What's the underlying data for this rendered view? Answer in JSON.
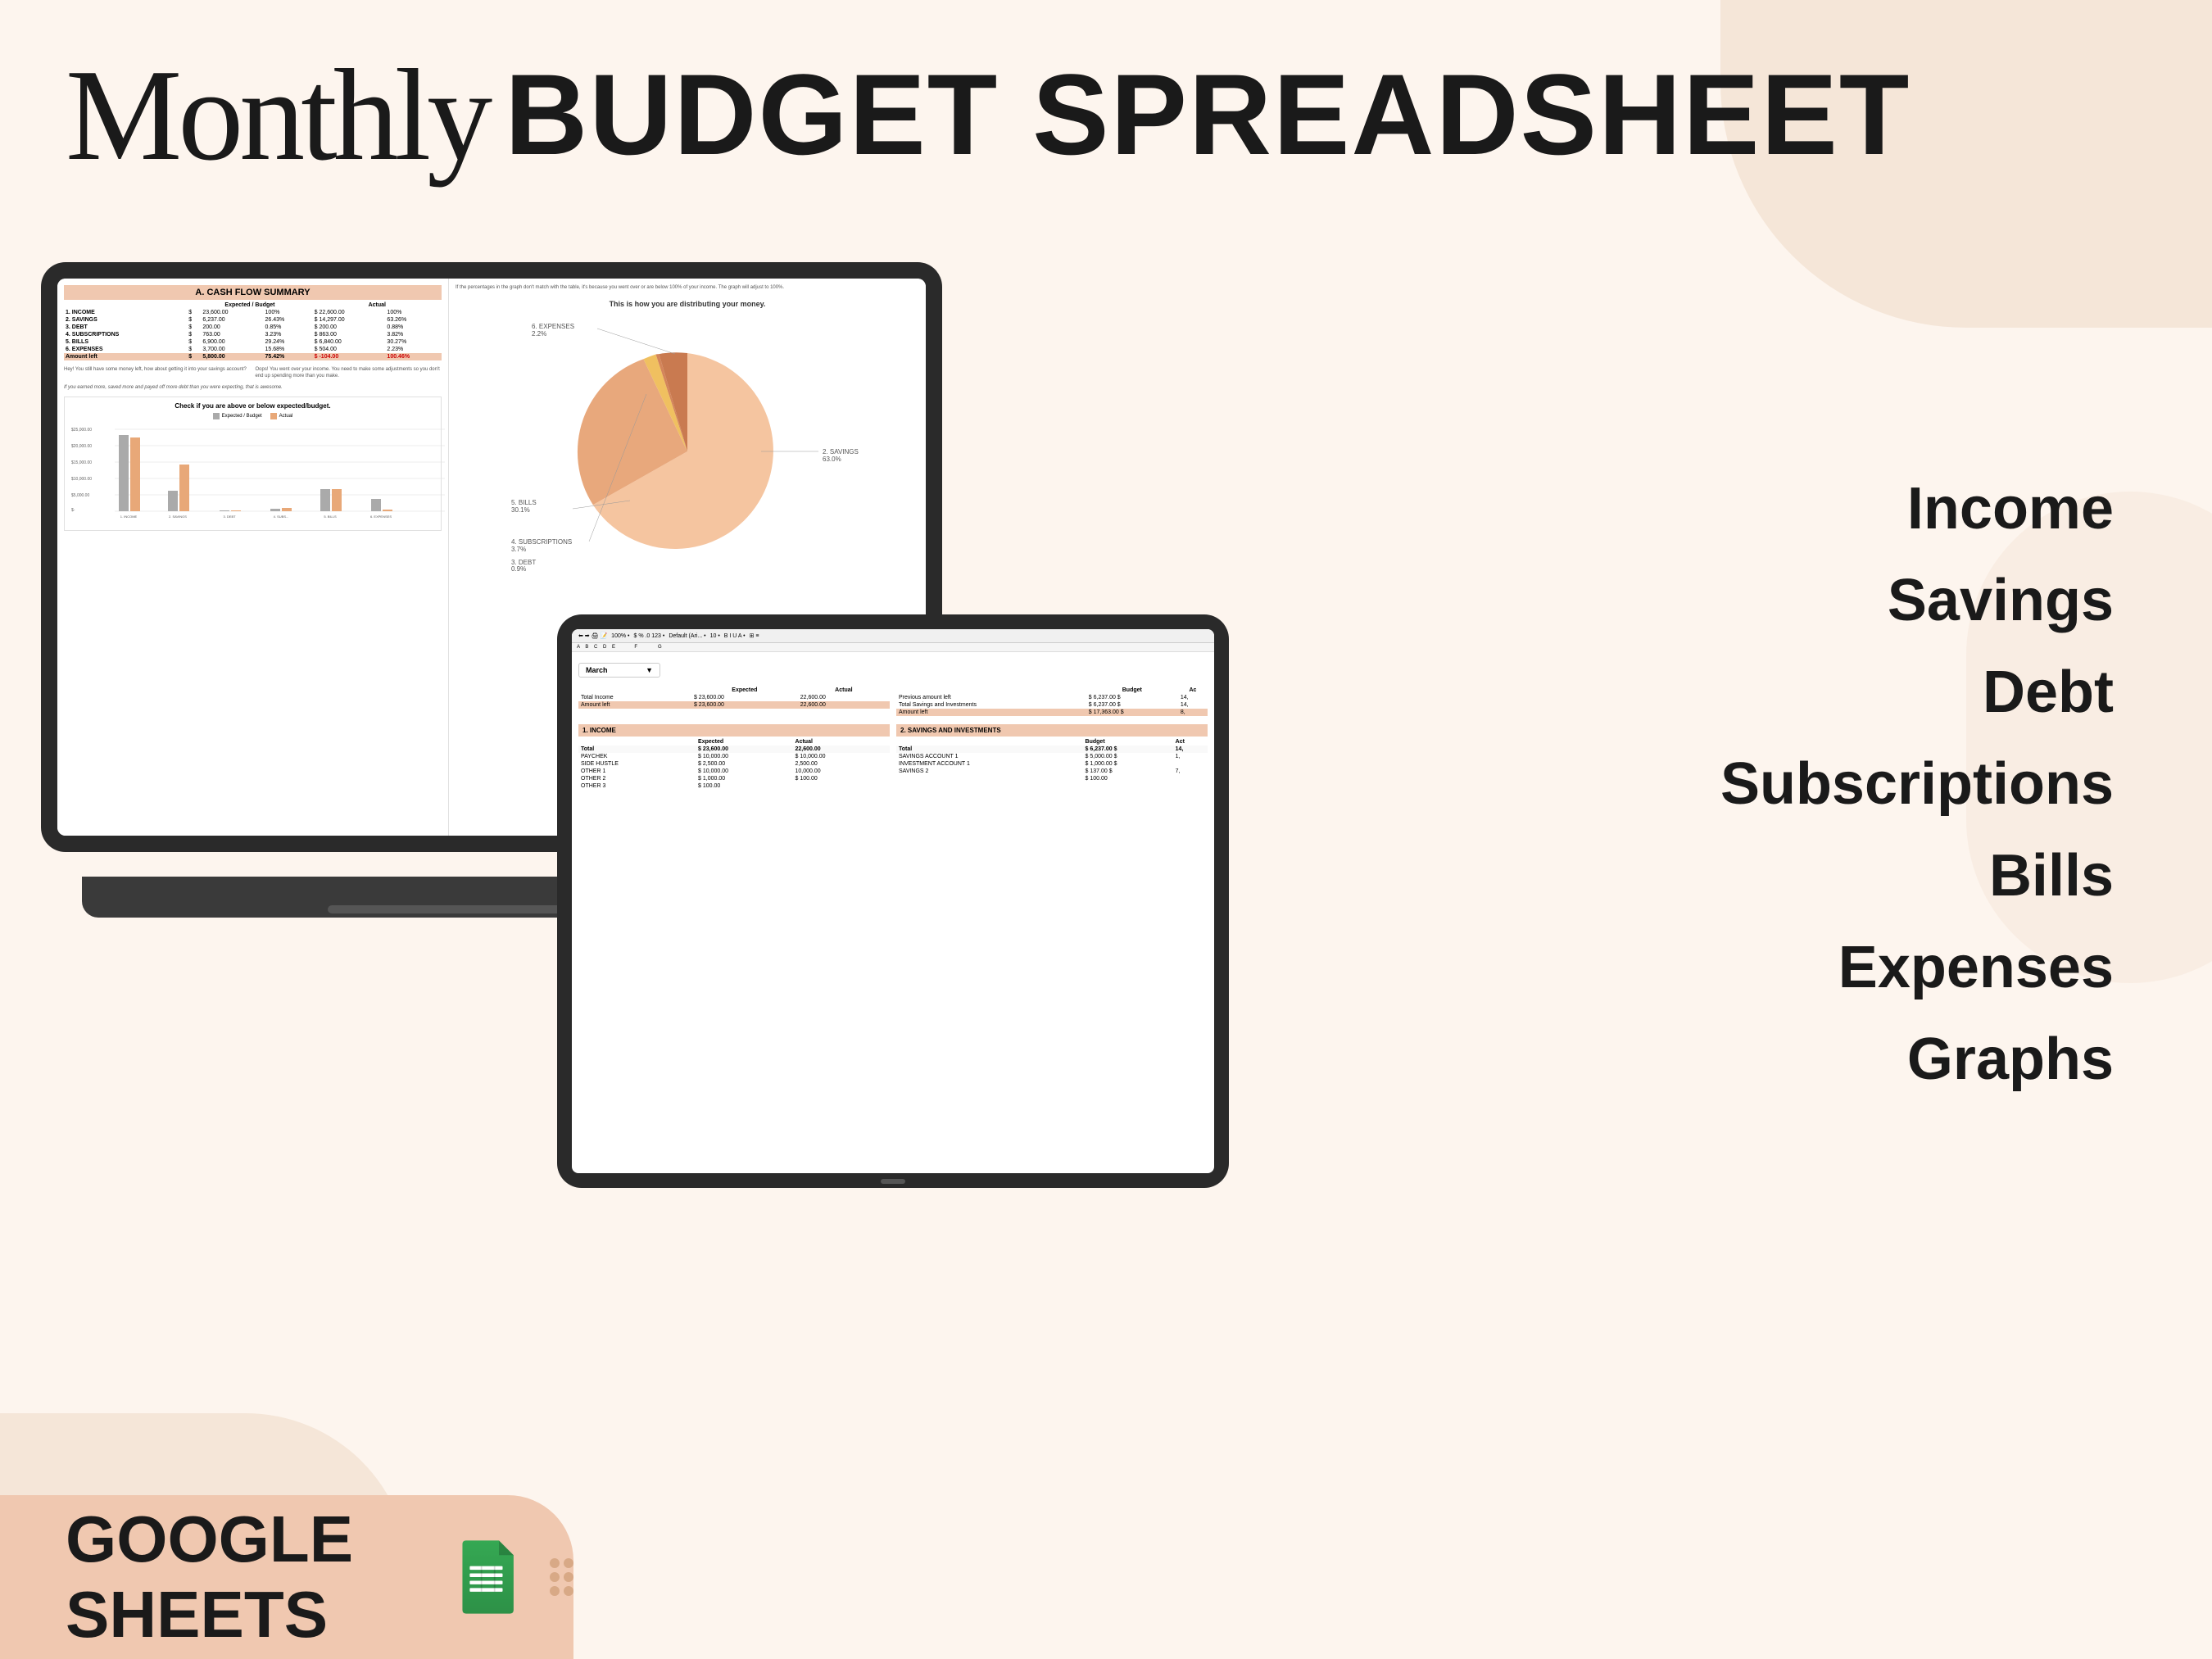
{
  "header": {
    "monthly_script": "Monthly",
    "budget_spreadsheet": "BUDGET SPREADSHEET"
  },
  "features": {
    "items": [
      "Income",
      "Savings",
      "Debt",
      "Subscriptions",
      "Bills",
      "Expenses",
      "Graphs"
    ]
  },
  "laptop": {
    "cash_flow": {
      "title": "A. CASH FLOW SUMMARY",
      "col_expected": "Expected / Budget",
      "col_actual": "Actual",
      "rows": [
        {
          "label": "1. INCOME",
          "exp_dollar": "$",
          "exp_val": "23,600.00",
          "exp_pct": "100%",
          "act_dollar": "$",
          "act_val": "22,600.00",
          "act_pct": "100%"
        },
        {
          "label": "2. SAVINGS",
          "exp_dollar": "$",
          "exp_val": "6,237.00",
          "exp_pct": "26.43%",
          "act_dollar": "$",
          "act_val": "14,297.00",
          "act_pct": "63.26%"
        },
        {
          "label": "3. DEBT",
          "exp_dollar": "$",
          "exp_val": "200.00",
          "exp_pct": "0.85%",
          "act_dollar": "$",
          "act_val": "200.00",
          "act_pct": "0.88%"
        },
        {
          "label": "4. SUBSCRIPTIONS",
          "exp_dollar": "$",
          "exp_val": "763.00",
          "exp_pct": "3.23%",
          "act_dollar": "$",
          "act_val": "863.00",
          "act_pct": "3.82%"
        },
        {
          "label": "5. BILLS",
          "exp_dollar": "$",
          "exp_val": "6,900.00",
          "exp_pct": "29.24%",
          "act_dollar": "$",
          "act_val": "6,840.00",
          "act_pct": "30.27%"
        },
        {
          "label": "6. EXPENSES",
          "exp_dollar": "$",
          "exp_val": "3,700.00",
          "exp_pct": "15.68%",
          "act_dollar": "$",
          "act_val": "504.00",
          "act_pct": "2.23%"
        }
      ],
      "amount_left_label": "Amount left",
      "amount_left_exp": "5,800.00",
      "amount_left_exp_pct": "75.42%",
      "amount_left_act": "-104.00",
      "amount_left_act_pct": "100.46%",
      "note_positive": "Hey! You still have some money left, how about getting it into your savings account?",
      "note_negative": "Oops! You went over your income. You need to make some adjustments so you don't end up spending more than you make.",
      "italic_note": "If you earned more, saved more and payed off more debt than you were expecting, that is awesome."
    },
    "pie_chart": {
      "disclaimer": "If the percentages in the graph don't match with the table, it's because you went over or are below 100% of your income. The graph will adjust to 100%.",
      "title": "This is how you are distributing your money.",
      "segments": [
        {
          "label": "2. SAVINGS",
          "pct": "63.0%",
          "color": "#f5c5a0"
        },
        {
          "label": "5. BILLS",
          "pct": "30.1%",
          "color": "#e8a87c"
        },
        {
          "label": "4. SUBSCRIPTIONS",
          "pct": "3.7%",
          "color": "#f0c060"
        },
        {
          "label": "3. DEBT",
          "pct": "0.9%",
          "color": "#d4855a"
        },
        {
          "label": "6. EXPENSES",
          "pct": "2.2%",
          "color": "#c97a50"
        }
      ]
    },
    "bar_chart": {
      "title": "Check if you are above or below expected/budget.",
      "legend_expected": "Expected / Budget",
      "legend_actual": "Actual",
      "categories": [
        "1. INCOME",
        "2. SAVINGS",
        "3. DEBT",
        "4. SUBSCRIPTIONS",
        "5. BILLS",
        "6. EXPENSES"
      ],
      "expected_values": [
        23600,
        6237,
        200,
        763,
        6900,
        3700
      ],
      "actual_values": [
        22600,
        14297,
        200,
        863,
        6840,
        504
      ],
      "y_labels": [
        "$25,000.00",
        "$20,000.00",
        "$15,000.00",
        "$10,000.00",
        "$5,000.00",
        "$-"
      ]
    }
  },
  "tablet": {
    "month": "March",
    "dropdown_arrow": "▼",
    "expected_label": "Expected",
    "actual_label": "Actual",
    "budget_label": "Budget",
    "total_income_label": "Total Income",
    "total_income_exp": "$ 23,600.00",
    "total_income_act": "22,600.00",
    "prev_amount_left_label": "Previous amount left",
    "prev_amount_left_budget": "$ 6,237.00 $",
    "amount_left_label": "Amount left",
    "amount_left_exp": "$ 23,600.00",
    "amount_left_act": "22,600.00",
    "total_savings_label": "Total Savings and Investments",
    "total_savings_budget": "$ 6,237.00 $",
    "total_savings_act": "14,",
    "amount_left2": "Amount left",
    "amount_left2_budget": "$ 17,363.00 $",
    "amount_left2_act": "8,",
    "income_section": "1. INCOME",
    "savings_section": "2. SAVINGS AND INVESTMENTS",
    "income_table": {
      "headers": [
        "",
        "Expected",
        "Actual"
      ],
      "total_row": [
        "Total",
        "$ 23,600.00",
        "22,600.00"
      ],
      "rows": [
        {
          "label": "PAYCHEK",
          "exp": "$ 10,000.00",
          "act": "$ 10,000.00"
        },
        {
          "label": "SIDE HUSTLE",
          "exp": "$ 2,500.00",
          "act": "2,500.00"
        },
        {
          "label": "OTHER 1",
          "exp": "$ 10,000.00",
          "act": "10,000.00"
        },
        {
          "label": "OTHER 2",
          "exp": "$ 1,000.00",
          "act": "$ 100.00"
        },
        {
          "label": "OTHER 3",
          "exp": "$ 100.00",
          "act": ""
        }
      ]
    },
    "savings_table": {
      "headers": [
        "",
        "Budget",
        "Act"
      ],
      "total_row": [
        "Total",
        "$ 6,237.00 $",
        "14,"
      ],
      "rows": [
        {
          "label": "SAVINGS ACCOUNT 1",
          "budget": "$ 5,000.00 $",
          "act": "1,"
        },
        {
          "label": "INVESTMENT ACCOUNT 1",
          "budget": "$ 1,000.00 $",
          "act": ""
        },
        {
          "label": "SAVINGS 2",
          "budget": "$ 137.00 $",
          "act": "7,"
        },
        {
          "label": "",
          "budget": "$ 100.00",
          "act": ""
        }
      ]
    }
  },
  "google_sheets_badge": {
    "text": "GOOGLE SHEETS"
  }
}
